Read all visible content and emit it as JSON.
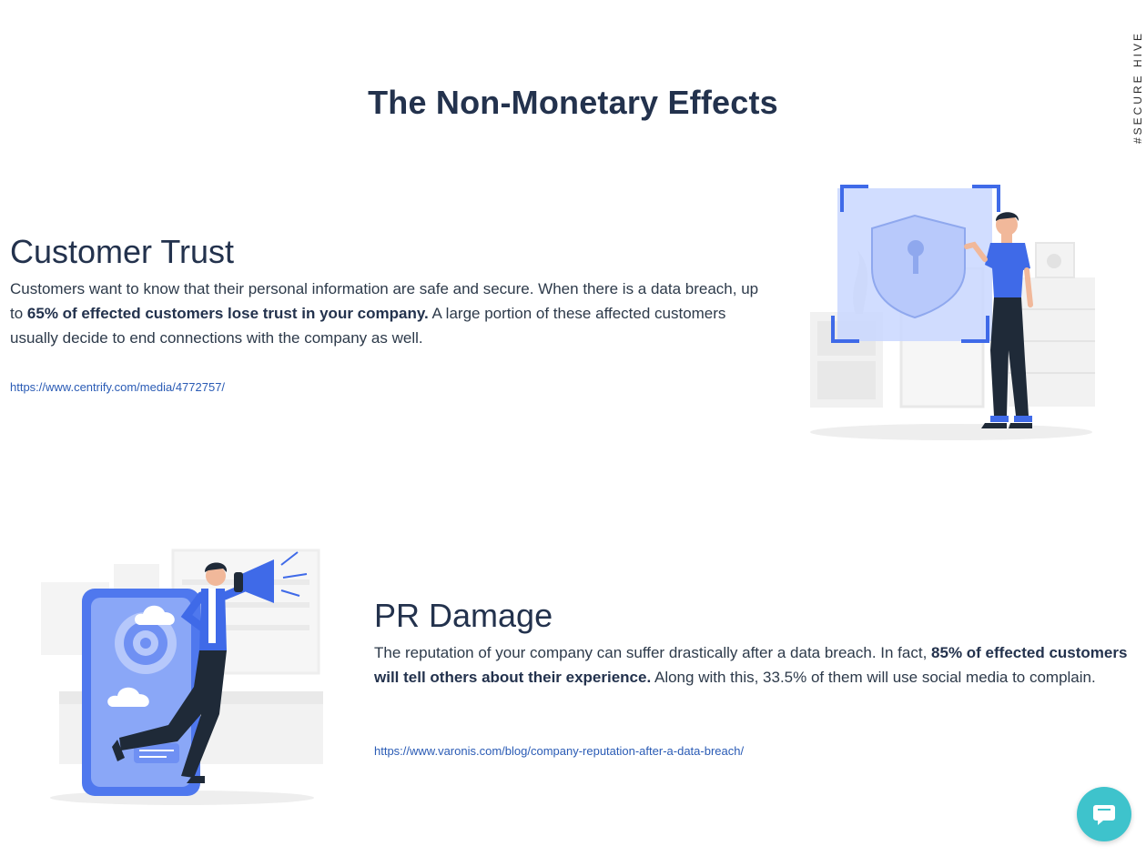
{
  "page": {
    "title": "The Non-Monetary Effects",
    "side_tag": "#SECURE HIVE"
  },
  "sections": [
    {
      "heading": "Customer Trust",
      "text_before": "Customers want to know that their personal information are safe and secure. When there is a data breach, up to ",
      "text_bold": "65% of effected customers lose trust in your company.",
      "text_after": " A large portion of these affected customers usually decide to end connections with the company as well.",
      "link": "https://www.centrify.com/media/4772757/",
      "illustration_icon": "security-shield-person-illustration"
    },
    {
      "heading": "PR Damage",
      "text_before": "The reputation of your company can suffer drastically after a data breach. In fact, ",
      "text_bold": "85% of effected customers will tell others about their experience.",
      "text_after": " Along with this, 33.5% of them will use social media to complain.",
      "link": "https://www.varonis.com/blog/company-reputation-after-a-data-breach/",
      "illustration_icon": "megaphone-person-illustration"
    }
  ],
  "chat": {
    "icon": "chat-bubble-icon",
    "color": "#3ec3cc"
  },
  "colors": {
    "heading": "#23324d",
    "link": "#2a5bb5",
    "accent": "#3f6ae8"
  }
}
